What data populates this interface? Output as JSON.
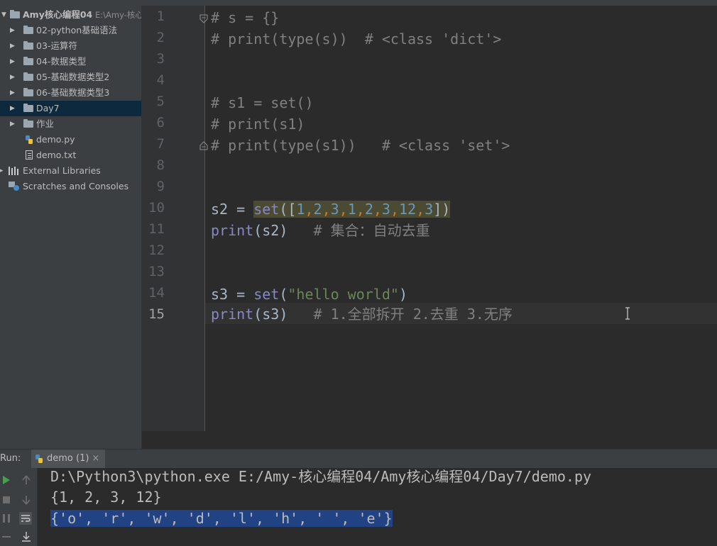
{
  "project_tree": {
    "root_label": "Amy核心编程04",
    "root_path": "E:\\Amy-核心",
    "items": [
      {
        "label": "02-python基础语法"
      },
      {
        "label": "03-运算符"
      },
      {
        "label": "04-数据类型"
      },
      {
        "label": "05-基础数据类型2"
      },
      {
        "label": "06-基础数据类型3"
      },
      {
        "label": "Day7"
      },
      {
        "label": "作业"
      },
      {
        "label": "demo.py"
      },
      {
        "label": "demo.txt"
      },
      {
        "label": "External Libraries"
      },
      {
        "label": "Scratches and Consoles"
      }
    ]
  },
  "editor": {
    "line_numbers": [
      "1",
      "2",
      "3",
      "4",
      "5",
      "6",
      "7",
      "8",
      "9",
      "10",
      "11",
      "12",
      "13",
      "14",
      "15"
    ],
    "current_line": "15",
    "lines": {
      "l1": "# s = {}",
      "l2": "# print(type(s))  # <class 'dict'>",
      "l5": "# s1 = set()",
      "l6": "# print(s1)",
      "l7": "# print(type(s1))   # <class 'set'>",
      "l10_a": "s2 = ",
      "l10_fn": "set",
      "l10_open": "([",
      "l10_n1": "1",
      "l10_n2": "2",
      "l10_n3": "3",
      "l10_n4": "1",
      "l10_n5": "2",
      "l10_n6": "3",
      "l10_n7": "12",
      "l10_n8": "3",
      "l10_sep": ",",
      "l10_close": "])",
      "l11_fn": "print",
      "l11_args": "(s2)   ",
      "l11_cmt": "# 集合：自动去重",
      "l14_a": "s3 = ",
      "l14_fn": "set",
      "l14_open": "(",
      "l14_str": "\"hello world\"",
      "l14_close": ")",
      "l15_fn": "print",
      "l15_args": "(s3)   ",
      "l15_cmt": "# 1.全部拆开 2.去重 3.无序"
    }
  },
  "run_panel": {
    "label": "Run:",
    "tab_label": "demo (1)",
    "close": "×",
    "output": [
      "D:\\Python3\\python.exe E:/Amy-核心编程04/Amy核心编程04/Day7/demo.py",
      "{1, 2, 3, 12}",
      "{'o', 'r', 'w', 'd', 'l', 'h', ' ', 'e'}"
    ]
  },
  "colors": {
    "background": "#2b2b2b",
    "comment": "#808080",
    "keyword": "#8888c6",
    "string": "#6a8759",
    "number": "#6897bb",
    "selection": "#214283",
    "tree_selected": "#0d293e"
  }
}
